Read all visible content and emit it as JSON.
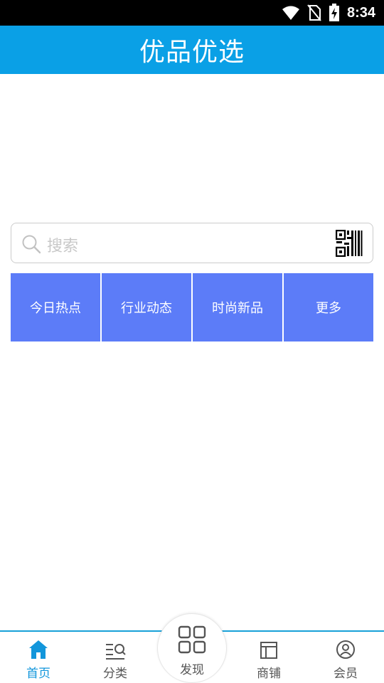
{
  "status_bar": {
    "time": "8:34",
    "icons": [
      "wifi-icon",
      "no-sim-icon",
      "battery-charging-icon"
    ]
  },
  "header": {
    "title": "优品优选"
  },
  "search": {
    "placeholder": "搜索",
    "icons": [
      "search-icon",
      "qr-scan-icon"
    ]
  },
  "quick_menu": [
    {
      "label": "今日热点"
    },
    {
      "label": "行业动态"
    },
    {
      "label": "时尚新品"
    },
    {
      "label": "更多"
    }
  ],
  "tab_bar": {
    "tabs": [
      {
        "label": "首页",
        "icon": "home-icon",
        "active": true
      },
      {
        "label": "分类",
        "icon": "category-icon",
        "active": false
      },
      {
        "label": "发现",
        "icon": "discover-grid-icon",
        "active": false
      },
      {
        "label": "商铺",
        "icon": "shop-icon",
        "active": false
      },
      {
        "label": "会员",
        "icon": "member-icon",
        "active": false
      }
    ]
  },
  "colors": {
    "header_bg": "#0aa0e6",
    "menu_tile_bg": "#5c7cf8",
    "tab_active": "#1296db",
    "tab_inactive": "#555555"
  }
}
